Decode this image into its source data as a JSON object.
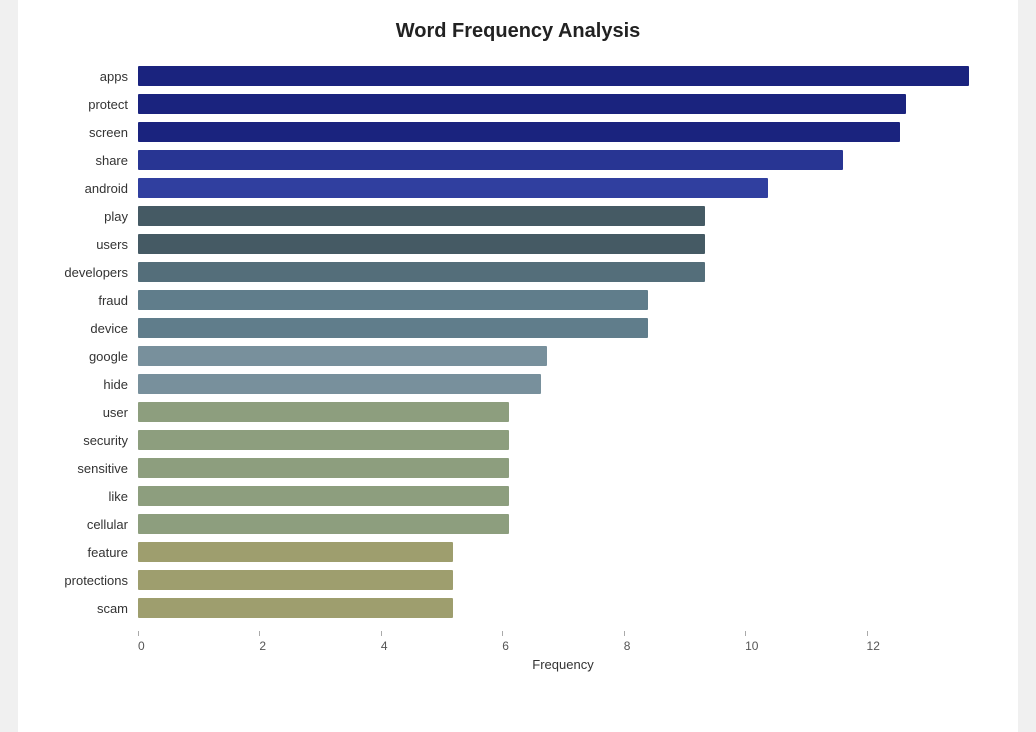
{
  "chart": {
    "title": "Word Frequency Analysis",
    "x_axis_label": "Frequency",
    "x_ticks": [
      0,
      2,
      4,
      6,
      8,
      10,
      12
    ],
    "max_value": 13.5,
    "bars": [
      {
        "label": "apps",
        "value": 13.2,
        "color": "#1a237e"
      },
      {
        "label": "protect",
        "value": 12.2,
        "color": "#1a237e"
      },
      {
        "label": "screen",
        "value": 12.1,
        "color": "#1a237e"
      },
      {
        "label": "share",
        "value": 11.2,
        "color": "#283593"
      },
      {
        "label": "android",
        "value": 10.0,
        "color": "#303f9f"
      },
      {
        "label": "play",
        "value": 9.0,
        "color": "#455a64"
      },
      {
        "label": "users",
        "value": 9.0,
        "color": "#455a64"
      },
      {
        "label": "developers",
        "value": 9.0,
        "color": "#546e7a"
      },
      {
        "label": "fraud",
        "value": 8.1,
        "color": "#607d8b"
      },
      {
        "label": "device",
        "value": 8.1,
        "color": "#607d8b"
      },
      {
        "label": "google",
        "value": 6.5,
        "color": "#78909c"
      },
      {
        "label": "hide",
        "value": 6.4,
        "color": "#78909c"
      },
      {
        "label": "user",
        "value": 5.9,
        "color": "#8d9e7e"
      },
      {
        "label": "security",
        "value": 5.9,
        "color": "#8d9e7e"
      },
      {
        "label": "sensitive",
        "value": 5.9,
        "color": "#8d9e7e"
      },
      {
        "label": "like",
        "value": 5.9,
        "color": "#8d9e7e"
      },
      {
        "label": "cellular",
        "value": 5.9,
        "color": "#8d9e7e"
      },
      {
        "label": "feature",
        "value": 5.0,
        "color": "#9e9e6e"
      },
      {
        "label": "protections",
        "value": 5.0,
        "color": "#9e9e6e"
      },
      {
        "label": "scam",
        "value": 5.0,
        "color": "#9e9e6e"
      }
    ]
  }
}
